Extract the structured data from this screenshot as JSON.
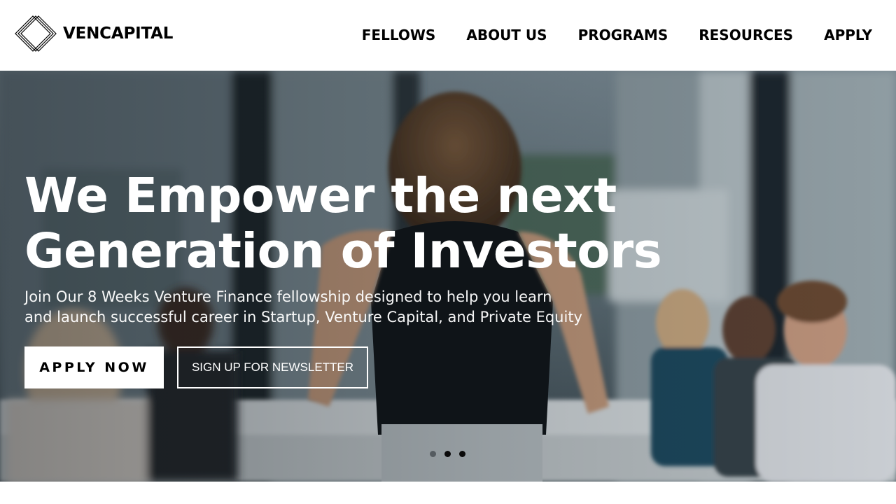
{
  "brand": {
    "name": "VENCAPITAL",
    "logo_icon": "nested-diamond-icon"
  },
  "nav": {
    "items": [
      {
        "label": "FELLOWS"
      },
      {
        "label": "ABOUT US"
      },
      {
        "label": "PROGRAMS"
      },
      {
        "label": "RESOURCES"
      },
      {
        "label": "APPLY"
      }
    ]
  },
  "hero": {
    "title_lines": [
      "We Empower the next",
      "Generation of Investors"
    ],
    "subtitle_lines": [
      "Join Our 8 Weeks Venture Finance fellowship designed to help you learn",
      "and launch successful career in Startup, Venture Capital, and Private Equity"
    ],
    "primary_button": "APPLY NOW",
    "secondary_button": "SIGN UP FOR NEWSLETTER",
    "background_image": "woman-presenting-to-seated-colleagues-in-office",
    "slider": {
      "total": 3,
      "active": 1
    }
  },
  "colors": {
    "text": "#000000",
    "header_bg": "#ffffff",
    "hero_text": "#ffffff"
  }
}
